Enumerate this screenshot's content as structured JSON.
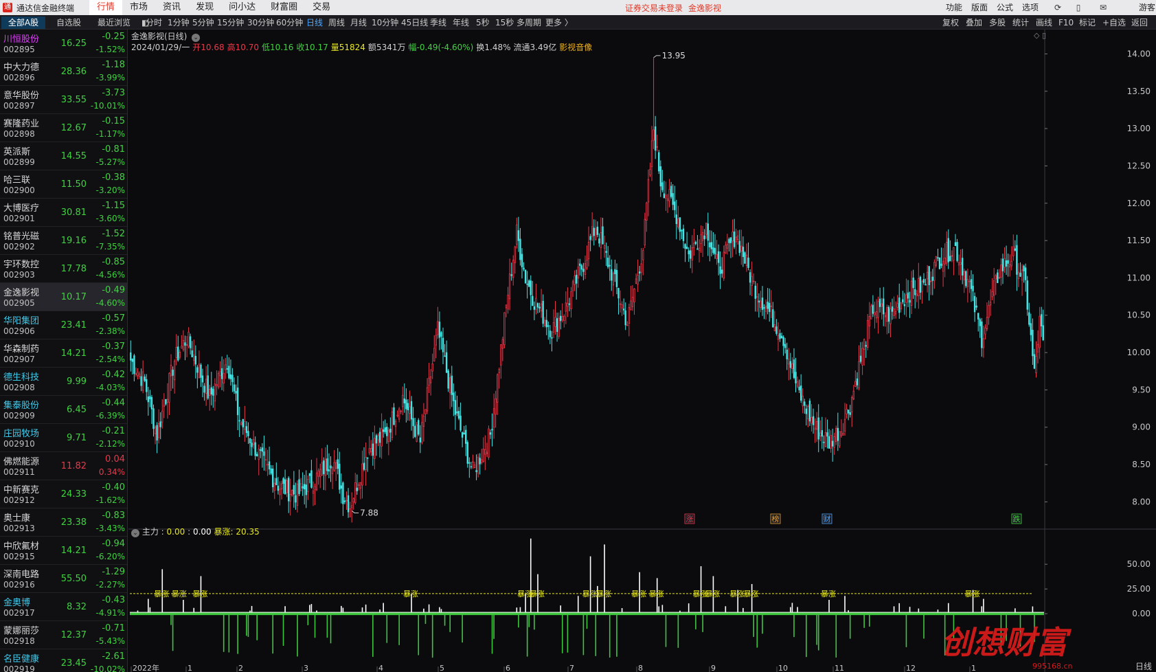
{
  "app": {
    "title": "通达信金融终端",
    "login_status": "证券交易未登录",
    "current_stock_label": "金逸影视"
  },
  "top_menu": [
    {
      "label": "行情",
      "active": true
    },
    {
      "label": "市场",
      "active": false
    },
    {
      "label": "资讯",
      "active": false
    },
    {
      "label": "发现",
      "active": false
    },
    {
      "label": "问小达",
      "active": false
    },
    {
      "label": "财富圈",
      "active": false
    },
    {
      "label": "交易",
      "active": false
    }
  ],
  "right_menu": [
    "功能",
    "版面",
    "公式",
    "选项"
  ],
  "guest_label": "游客",
  "list_tabs": [
    {
      "label": "全部A股",
      "active": true
    },
    {
      "label": "自选股",
      "active": false
    },
    {
      "label": "最近浏览",
      "active": false
    }
  ],
  "period_tabs": [
    {
      "label": "分时",
      "active": false
    },
    {
      "label": "1分钟",
      "active": false
    },
    {
      "label": "5分钟",
      "active": false
    },
    {
      "label": "15分钟",
      "active": false
    },
    {
      "label": "30分钟",
      "active": false
    },
    {
      "label": "60分钟",
      "active": false
    },
    {
      "label": "日线",
      "active": true
    },
    {
      "label": "周线",
      "active": false
    },
    {
      "label": "月线",
      "active": false
    },
    {
      "label": "10分钟",
      "active": false
    },
    {
      "label": "45日线",
      "active": false
    },
    {
      "label": "季线",
      "active": false
    },
    {
      "label": "年线",
      "active": false
    },
    {
      "label": "5秒",
      "active": false
    },
    {
      "label": "15秒",
      "active": false
    },
    {
      "label": "多周期",
      "active": false
    },
    {
      "label": "更多 〉",
      "active": false
    }
  ],
  "tool_buttons": [
    "复权",
    "叠加",
    "多股",
    "统计",
    "画线",
    "F10",
    "标记",
    "+自选",
    "返回"
  ],
  "stock_list": [
    {
      "name": "川恒股份",
      "code": "002895",
      "price": "16.25",
      "change": "-0.25",
      "pct": "-1.52%",
      "name_color": "#e040fb",
      "selected": false
    },
    {
      "name": "中大力德",
      "code": "002896",
      "price": "28.36",
      "change": "-1.18",
      "pct": "-3.99%",
      "name_color": "#d8d8d8",
      "selected": false
    },
    {
      "name": "意华股份",
      "code": "002897",
      "price": "33.55",
      "change": "-3.73",
      "pct": "-10.01%",
      "name_color": "#d8d8d8",
      "selected": false
    },
    {
      "name": "赛隆药业",
      "code": "002898",
      "price": "12.67",
      "change": "-0.15",
      "pct": "-1.17%",
      "name_color": "#d8d8d8",
      "selected": false
    },
    {
      "name": "英派斯",
      "code": "002899",
      "price": "14.55",
      "change": "-0.81",
      "pct": "-5.27%",
      "name_color": "#d8d8d8",
      "selected": false
    },
    {
      "name": "哈三联",
      "code": "002900",
      "price": "11.50",
      "change": "-0.38",
      "pct": "-3.20%",
      "name_color": "#d8d8d8",
      "selected": false
    },
    {
      "name": "大博医疗",
      "code": "002901",
      "price": "30.81",
      "change": "-1.15",
      "pct": "-3.60%",
      "name_color": "#d8d8d8",
      "selected": false
    },
    {
      "name": "铭普光磁",
      "code": "002902",
      "price": "19.16",
      "change": "-1.52",
      "pct": "-7.35%",
      "name_color": "#d8d8d8",
      "selected": false
    },
    {
      "name": "宇环数控",
      "code": "002903",
      "price": "17.78",
      "change": "-0.85",
      "pct": "-4.56%",
      "name_color": "#d8d8d8",
      "selected": false
    },
    {
      "name": "金逸影视",
      "code": "002905",
      "price": "10.17",
      "change": "-0.49",
      "pct": "-4.60%",
      "name_color": "#d8d8d8",
      "selected": true
    },
    {
      "name": "华阳集团",
      "code": "002906",
      "price": "23.41",
      "change": "-0.57",
      "pct": "-2.38%",
      "name_color": "#40c8e8",
      "selected": false
    },
    {
      "name": "华森制药",
      "code": "002907",
      "price": "14.21",
      "change": "-0.37",
      "pct": "-2.54%",
      "name_color": "#d8d8d8",
      "selected": false
    },
    {
      "name": "德生科技",
      "code": "002908",
      "price": "9.99",
      "change": "-0.42",
      "pct": "-4.03%",
      "name_color": "#40c8e8",
      "selected": false
    },
    {
      "name": "集泰股份",
      "code": "002909",
      "price": "6.45",
      "change": "-0.44",
      "pct": "-6.39%",
      "name_color": "#40c8e8",
      "selected": false
    },
    {
      "name": "庄园牧场",
      "code": "002910",
      "price": "9.71",
      "change": "-0.21",
      "pct": "-2.12%",
      "name_color": "#40c8e8",
      "selected": false
    },
    {
      "name": "佛燃能源",
      "code": "002911",
      "price": "11.82",
      "change": "0.04",
      "pct": "0.34%",
      "name_color": "#d8d8d8",
      "selected": false
    },
    {
      "name": "中新赛克",
      "code": "002912",
      "price": "24.33",
      "change": "-0.40",
      "pct": "-1.62%",
      "name_color": "#d8d8d8",
      "selected": false
    },
    {
      "name": "奥士康",
      "code": "002913",
      "price": "23.38",
      "change": "-0.83",
      "pct": "-3.43%",
      "name_color": "#d8d8d8",
      "selected": false
    },
    {
      "name": "中欣氟材",
      "code": "002915",
      "price": "14.21",
      "change": "-0.94",
      "pct": "-6.20%",
      "name_color": "#d8d8d8",
      "selected": false
    },
    {
      "name": "深南电路",
      "code": "002916",
      "price": "55.50",
      "change": "-1.29",
      "pct": "-2.27%",
      "name_color": "#d8d8d8",
      "selected": false
    },
    {
      "name": "金奥博",
      "code": "002917",
      "price": "8.32",
      "change": "-0.43",
      "pct": "-4.91%",
      "name_color": "#40c8e8",
      "selected": false
    },
    {
      "name": "蒙娜丽莎",
      "code": "002918",
      "price": "12.37",
      "change": "-0.71",
      "pct": "-5.43%",
      "name_color": "#d8d8d8",
      "selected": false
    },
    {
      "name": "名臣健康",
      "code": "002919",
      "price": "23.45",
      "change": "-2.61",
      "pct": "-10.02%",
      "name_color": "#40c8e8",
      "selected": false
    }
  ],
  "chart_header": {
    "title": "金逸影视(日线)"
  },
  "quote": {
    "date": "2024/01/29/一",
    "open_label": "开",
    "open": "10.68",
    "high_label": "高",
    "high": "10.70",
    "low_label": "低",
    "low": "10.16",
    "close_label": "收",
    "close": "10.17",
    "volume_label": "量",
    "volume": "51824",
    "amount_label": "额",
    "amount": "5341万",
    "range_label": "幅",
    "range": "-0.49(-4.60%)",
    "turnover_label": "换",
    "turnover": "1.48%",
    "float_label": "流通",
    "float_cap": "3.49亿",
    "sector": "影视音像"
  },
  "indicator": {
    "name": "主力",
    "value1": "0.00",
    "value2": "0.00",
    "label": "暴涨",
    "value3": "20.35"
  },
  "watermark": {
    "text": "创想财富",
    "url": "995168.cn"
  },
  "colors": {
    "up": "#e8394a",
    "down": "#45e6e6",
    "flat": "#d8d8d8",
    "accent": "#4ea6ff",
    "indicator_pos": "#ffffff",
    "indicator_neg": "#3fc63f",
    "signal_line": "#e8e820"
  },
  "chart_data": {
    "type": "candlestick",
    "price_axis": {
      "ticks": [
        "14.00",
        "13.50",
        "13.00",
        "12.50",
        "12.00",
        "11.50",
        "11.00",
        "10.50",
        "10.00",
        "9.50",
        "9.00",
        "8.50",
        "8.00"
      ],
      "range": [
        7.7,
        14.05
      ]
    },
    "annotations": {
      "max_label": "13.95",
      "min_label": "7.88"
    },
    "event_markers": [
      "涨",
      "榜",
      "财",
      "跌"
    ],
    "x_axis_labels": [
      "2022年",
      "1",
      "2",
      "3",
      "4",
      "5",
      "6",
      "7",
      "8",
      "9",
      "10",
      "11",
      "12",
      "1"
    ],
    "right_axis_corner_label": "日线",
    "indicator_axis": {
      "ticks": [
        "50.00",
        "25.00",
        "0.00"
      ],
      "range": [
        -52,
        80
      ]
    },
    "signal_label": "暴涨",
    "signal_value": 20.35,
    "close_anchors": [
      [
        0,
        9.9
      ],
      [
        8,
        9.6
      ],
      [
        15,
        8.9
      ],
      [
        25,
        9.9
      ],
      [
        32,
        10.2
      ],
      [
        45,
        9.4
      ],
      [
        55,
        9.9
      ],
      [
        62,
        9.1
      ],
      [
        67,
        8.9
      ],
      [
        76,
        8.5
      ],
      [
        85,
        8.2
      ],
      [
        95,
        8.1
      ],
      [
        105,
        8.3
      ],
      [
        115,
        8.6
      ],
      [
        121,
        8.1
      ],
      [
        125,
        7.95
      ],
      [
        135,
        8.7
      ],
      [
        145,
        8.9
      ],
      [
        155,
        9.4
      ],
      [
        165,
        8.8
      ],
      [
        175,
        10.3
      ],
      [
        185,
        9.2
      ],
      [
        195,
        8.4
      ],
      [
        205,
        8.9
      ],
      [
        215,
        10.8
      ],
      [
        220,
        11.6
      ],
      [
        225,
        11.0
      ],
      [
        230,
        10.7
      ],
      [
        240,
        10.3
      ],
      [
        248,
        10.6
      ],
      [
        258,
        11.2
      ],
      [
        265,
        11.7
      ],
      [
        275,
        11.0
      ],
      [
        283,
        10.4
      ],
      [
        292,
        11.4
      ],
      [
        298,
        13.0
      ],
      [
        302,
        12.3
      ],
      [
        312,
        11.8
      ],
      [
        318,
        11.3
      ],
      [
        328,
        11.7
      ],
      [
        335,
        11.1
      ],
      [
        345,
        11.6
      ],
      [
        355,
        10.9
      ],
      [
        365,
        10.5
      ],
      [
        372,
        10.2
      ],
      [
        380,
        9.5
      ],
      [
        390,
        9.0
      ],
      [
        398,
        8.8
      ],
      [
        405,
        9.0
      ],
      [
        410,
        9.3
      ],
      [
        415,
        9.8
      ],
      [
        423,
        10.6
      ],
      [
        433,
        10.5
      ],
      [
        443,
        10.8
      ],
      [
        452,
        10.9
      ],
      [
        462,
        11.3
      ],
      [
        470,
        11.4
      ],
      [
        478,
        10.9
      ],
      [
        485,
        10.2
      ],
      [
        495,
        11.1
      ],
      [
        503,
        11.3
      ],
      [
        510,
        10.9
      ],
      [
        515,
        9.7
      ],
      [
        518,
        10.4
      ],
      [
        520,
        10.17
      ]
    ],
    "volume_spikes": [
      [
        10,
        15
      ],
      [
        18,
        45
      ],
      [
        30,
        14
      ],
      [
        40,
        38
      ],
      [
        160,
        20
      ],
      [
        225,
        20
      ],
      [
        228,
        76
      ],
      [
        232,
        40
      ],
      [
        255,
        18
      ],
      [
        262,
        58
      ],
      [
        266,
        28
      ],
      [
        270,
        70
      ],
      [
        290,
        42
      ],
      [
        300,
        36
      ],
      [
        325,
        48
      ],
      [
        332,
        38
      ],
      [
        346,
        24
      ],
      [
        354,
        30
      ],
      [
        398,
        14
      ],
      [
        407,
        18
      ],
      [
        480,
        24
      ],
      [
        486,
        15
      ]
    ]
  }
}
